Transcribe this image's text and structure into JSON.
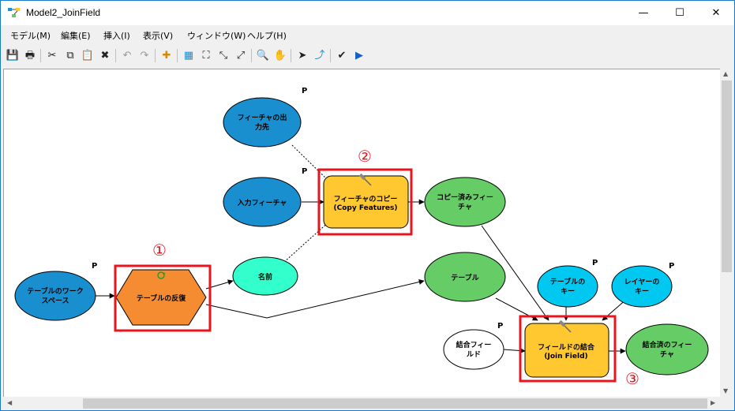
{
  "window": {
    "title": "Model2_JoinField",
    "minimize": "—",
    "maximize": "☐",
    "close": "✕"
  },
  "menu": [
    {
      "label": "モデル(M)"
    },
    {
      "label": "編集(E)"
    },
    {
      "label": "挿入(I)"
    },
    {
      "label": "表示(V)"
    },
    {
      "label": "ウィンドウ(W)"
    },
    {
      "label": "ヘルプ(H)"
    }
  ],
  "toolbar": [
    {
      "icon": "save-icon",
      "glyph": "💾"
    },
    {
      "icon": "print-icon",
      "glyph": "🖶"
    },
    {
      "icon": "cut-icon",
      "glyph": "✂"
    },
    {
      "icon": "copy-icon",
      "glyph": "⧉"
    },
    {
      "icon": "paste-icon",
      "glyph": "📋"
    },
    {
      "icon": "delete-icon",
      "glyph": "✖"
    },
    {
      "icon": "undo-icon",
      "glyph": "↶"
    },
    {
      "icon": "redo-icon",
      "glyph": "↷"
    },
    {
      "icon": "add-data-icon",
      "glyph": "✚"
    },
    {
      "icon": "auto-layout-icon",
      "glyph": "▦"
    },
    {
      "icon": "full-extent-icon",
      "glyph": "⛶"
    },
    {
      "icon": "zoom-in-fixed-icon",
      "glyph": "⤡"
    },
    {
      "icon": "zoom-out-fixed-icon",
      "glyph": "⤢"
    },
    {
      "icon": "zoom-in-icon",
      "glyph": "🔍"
    },
    {
      "icon": "pan-icon",
      "glyph": "✋"
    },
    {
      "icon": "select-icon",
      "glyph": "➤"
    },
    {
      "icon": "connect-icon",
      "glyph": "⤴"
    },
    {
      "icon": "validate-icon",
      "glyph": "✔"
    },
    {
      "icon": "run-icon",
      "glyph": "▶"
    }
  ],
  "colors": {
    "blue_variable": "#1a8fcf",
    "cyan_variable": "#00c8f0",
    "green_derived": "#66cc66",
    "tool_yellow": "#ffc830",
    "iterator_orange": "#f58c32",
    "teal_value": "#33ffcc",
    "highlight_red": "#e8141e"
  },
  "diagram": {
    "nodes": [
      {
        "id": "feature-output",
        "lines": [
          "フィーチャの出",
          "力先"
        ],
        "shape": "ellipse",
        "fill": "#1a8fcf",
        "param": "P"
      },
      {
        "id": "input-features",
        "lines": [
          "入力フィーチャ"
        ],
        "shape": "ellipse",
        "fill": "#1a8fcf",
        "param": "P"
      },
      {
        "id": "copy-features",
        "lines": [
          "フィーチャのコピー",
          "(Copy Features)"
        ],
        "shape": "tool",
        "fill": "#ffc830"
      },
      {
        "id": "copied-features",
        "lines": [
          "コピー済みフィー",
          "チャ"
        ],
        "shape": "ellipse",
        "fill": "#66cc66"
      },
      {
        "id": "table-workspace",
        "lines": [
          "テーブルのワーク",
          "スペース"
        ],
        "shape": "ellipse",
        "fill": "#1a8fcf",
        "param": "P"
      },
      {
        "id": "iterate-tables",
        "lines": [
          "テーブルの反復"
        ],
        "shape": "hexagon",
        "fill": "#f58c32"
      },
      {
        "id": "name",
        "lines": [
          "名前"
        ],
        "shape": "ellipse",
        "fill": "#33ffcc"
      },
      {
        "id": "table",
        "lines": [
          "テーブル"
        ],
        "shape": "ellipse",
        "fill": "#66cc66"
      },
      {
        "id": "table-key",
        "lines": [
          "テーブルの",
          "キー"
        ],
        "shape": "ellipse",
        "fill": "#00c8f0",
        "param": "P"
      },
      {
        "id": "layer-key",
        "lines": [
          "レイヤーの",
          "キー"
        ],
        "shape": "ellipse",
        "fill": "#00c8f0",
        "param": "P"
      },
      {
        "id": "join-field-input",
        "lines": [
          "結合フィー",
          "ルド"
        ],
        "shape": "ellipse",
        "fill": "#ffffff",
        "param": "P"
      },
      {
        "id": "join-field",
        "lines": [
          "フィールドの結合",
          "(Join Field)"
        ],
        "shape": "tool",
        "fill": "#ffc830"
      },
      {
        "id": "joined-features",
        "lines": [
          "結合済のフィー",
          "チャ"
        ],
        "shape": "ellipse",
        "fill": "#66cc66"
      }
    ],
    "markers": [
      {
        "id": "marker-1",
        "label": "①"
      },
      {
        "id": "marker-2",
        "label": "②"
      },
      {
        "id": "marker-3",
        "label": "③"
      }
    ]
  }
}
